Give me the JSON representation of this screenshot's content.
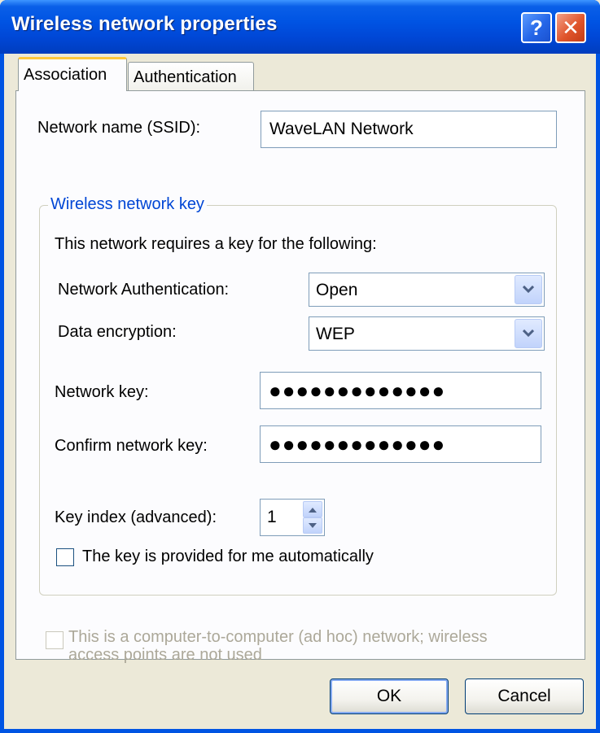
{
  "window": {
    "title": "Wireless network properties",
    "help_glyph": "?",
    "close_glyph": "✕"
  },
  "tabs": [
    {
      "label": "Association",
      "active": true
    },
    {
      "label": "Authentication",
      "active": false
    }
  ],
  "ssid": {
    "label": "Network name (SSID):",
    "value": "WaveLAN Network"
  },
  "wireless_key_group": {
    "title": "Wireless network key",
    "intro": "This network requires a key for the following:",
    "network_authentication": {
      "label": "Network Authentication:",
      "value": "Open"
    },
    "data_encryption": {
      "label": "Data encryption:",
      "value": "WEP"
    },
    "network_key": {
      "label": "Network key:",
      "masked": "●●●●●●●●●●●●●"
    },
    "confirm_key": {
      "label": "Confirm network key:",
      "masked": "●●●●●●●●●●●●●"
    },
    "key_index": {
      "label": "Key index (advanced):",
      "value": "1"
    },
    "auto_key": {
      "label": "The key is provided for me automatically",
      "checked": false
    }
  },
  "adhoc": {
    "label_line1": "This is a computer-to-computer (ad hoc) network; wireless",
    "label_line2": "access points are not used",
    "checked": false,
    "enabled": false
  },
  "buttons": {
    "ok": "OK",
    "cancel": "Cancel"
  },
  "colors": {
    "title_bar": "#0054e3",
    "dialog_bg": "#ece9d8",
    "group_title": "#0046d5",
    "disabled_text": "#aca899",
    "tab_highlight": "#ffc83c"
  }
}
